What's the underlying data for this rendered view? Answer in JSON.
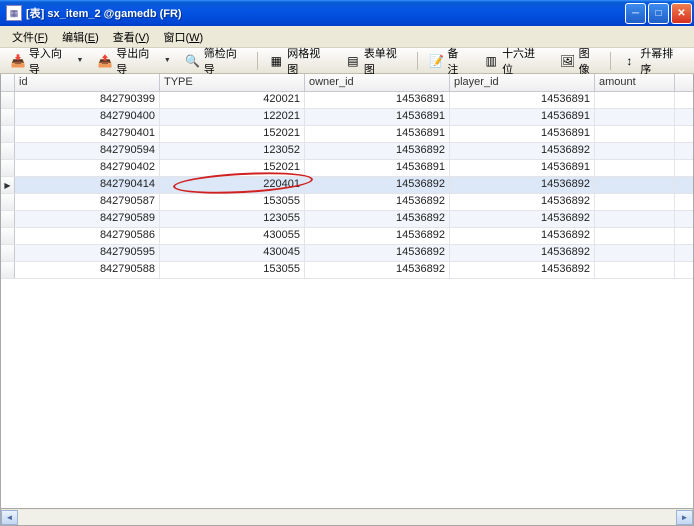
{
  "title": "[表] sx_item_2 @gamedb (FR)",
  "menu": {
    "file": "文件",
    "file_a": "F",
    "edit": "编辑",
    "edit_a": "E",
    "view": "查看",
    "view_a": "V",
    "window": "窗口",
    "window_a": "W"
  },
  "toolbar": {
    "import": "导入向导",
    "export": "导出向导",
    "filter": "筛检向导",
    "gridview": "网格视图",
    "formview": "表单视图",
    "memo": "备注",
    "hex": "十六进位",
    "image": "图像",
    "sort": "升幂排序"
  },
  "columns": {
    "id": "id",
    "type": "TYPE",
    "owner": "owner_id",
    "player": "player_id",
    "amount": "amount"
  },
  "rows": [
    {
      "id": "842790399",
      "type": "420021",
      "owner": "14536891",
      "player": "14536891"
    },
    {
      "id": "842790400",
      "type": "122021",
      "owner": "14536891",
      "player": "14536891"
    },
    {
      "id": "842790401",
      "type": "152021",
      "owner": "14536891",
      "player": "14536891"
    },
    {
      "id": "842790594",
      "type": "123052",
      "owner": "14536892",
      "player": "14536892"
    },
    {
      "id": "842790402",
      "type": "152021",
      "owner": "14536891",
      "player": "14536891"
    },
    {
      "id": "842790414",
      "type": "220401",
      "owner": "14536892",
      "player": "14536892"
    },
    {
      "id": "842790587",
      "type": "153055",
      "owner": "14536892",
      "player": "14536892"
    },
    {
      "id": "842790589",
      "type": "123055",
      "owner": "14536892",
      "player": "14536892"
    },
    {
      "id": "842790586",
      "type": "430055",
      "owner": "14536892",
      "player": "14536892"
    },
    {
      "id": "842790595",
      "type": "430045",
      "owner": "14536892",
      "player": "14536892"
    },
    {
      "id": "842790588",
      "type": "153055",
      "owner": "14536892",
      "player": "14536892"
    }
  ],
  "selected_row": 5
}
